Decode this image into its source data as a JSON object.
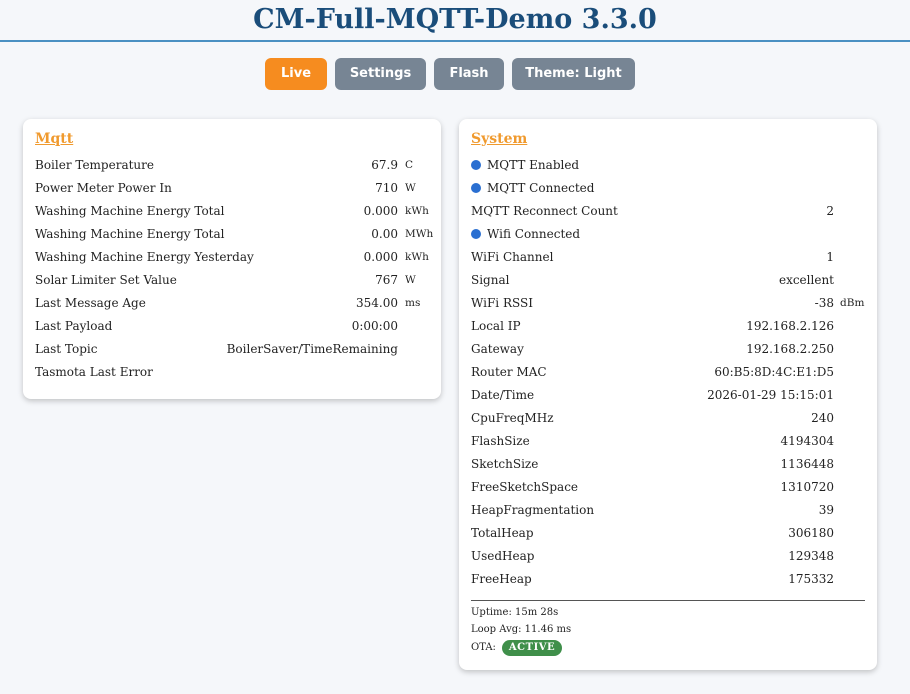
{
  "header": {
    "title": "CM-Full-MQTT-Demo 3.3.0"
  },
  "nav": {
    "live": "Live",
    "settings": "Settings",
    "flash": "Flash",
    "theme": "Theme: Light"
  },
  "mqtt": {
    "title": "Mqtt",
    "rows": [
      {
        "label": "Boiler Temperature",
        "value": "67.9",
        "unit": "C"
      },
      {
        "label": "Power Meter Power In",
        "value": "710",
        "unit": "W"
      },
      {
        "label": "Washing Machine Energy Total",
        "value": "0.000",
        "unit": "kWh"
      },
      {
        "label": "Washing Machine Energy Total",
        "value": "0.00",
        "unit": "MWh"
      },
      {
        "label": "Washing Machine Energy Yesterday",
        "value": "0.000",
        "unit": "kWh"
      },
      {
        "label": "Solar Limiter Set Value",
        "value": "767",
        "unit": "W"
      },
      {
        "label": "Last Message Age",
        "value": "354.00",
        "unit": "ms"
      },
      {
        "label": "Last Payload",
        "value": "0:00:00",
        "unit": ""
      },
      {
        "label": "Last Topic",
        "value": "BoilerSaver/TimeRemaining",
        "unit": ""
      },
      {
        "label": "Tasmota Last Error",
        "value": "",
        "unit": ""
      }
    ]
  },
  "system": {
    "title": "System",
    "rows": [
      {
        "label": "MQTT Enabled",
        "value": "",
        "unit": "",
        "indicator": true
      },
      {
        "label": "MQTT Connected",
        "value": "",
        "unit": "",
        "indicator": true
      },
      {
        "label": "MQTT Reconnect Count",
        "value": "2",
        "unit": ""
      },
      {
        "label": "Wifi Connected",
        "value": "",
        "unit": "",
        "indicator": true
      },
      {
        "label": "WiFi Channel",
        "value": "1",
        "unit": ""
      },
      {
        "label": "Signal",
        "value": "excellent",
        "unit": ""
      },
      {
        "label": "WiFi RSSI",
        "value": "-38",
        "unit": "dBm"
      },
      {
        "label": "Local IP",
        "value": "192.168.2.126",
        "unit": ""
      },
      {
        "label": "Gateway",
        "value": "192.168.2.250",
        "unit": ""
      },
      {
        "label": "Router MAC",
        "value": "60:B5:8D:4C:E1:D5",
        "unit": ""
      },
      {
        "label": "Date/Time",
        "value": "2026-01-29 15:15:01",
        "unit": ""
      },
      {
        "label": "CpuFreqMHz",
        "value": "240",
        "unit": ""
      },
      {
        "label": "FlashSize",
        "value": "4194304",
        "unit": ""
      },
      {
        "label": "SketchSize",
        "value": "1136448",
        "unit": ""
      },
      {
        "label": "FreeSketchSpace",
        "value": "1310720",
        "unit": ""
      },
      {
        "label": "HeapFragmentation",
        "value": "39",
        "unit": ""
      },
      {
        "label": "TotalHeap",
        "value": "306180",
        "unit": ""
      },
      {
        "label": "UsedHeap",
        "value": "129348",
        "unit": ""
      },
      {
        "label": "FreeHeap",
        "value": "175332",
        "unit": ""
      }
    ],
    "footer": {
      "uptime": "Uptime: 15m 28s",
      "loop_avg": "Loop Avg: 11.46 ms",
      "ota_label": "OTA:",
      "ota_status": "ACTIVE"
    }
  },
  "colors": {
    "title": "#1a4d7a",
    "active_button": "#f68c1f",
    "inactive_button": "#778594",
    "card_title": "#f09a2e",
    "indicator": "#2a6fd1",
    "ota_badge": "#3f8f4a"
  }
}
